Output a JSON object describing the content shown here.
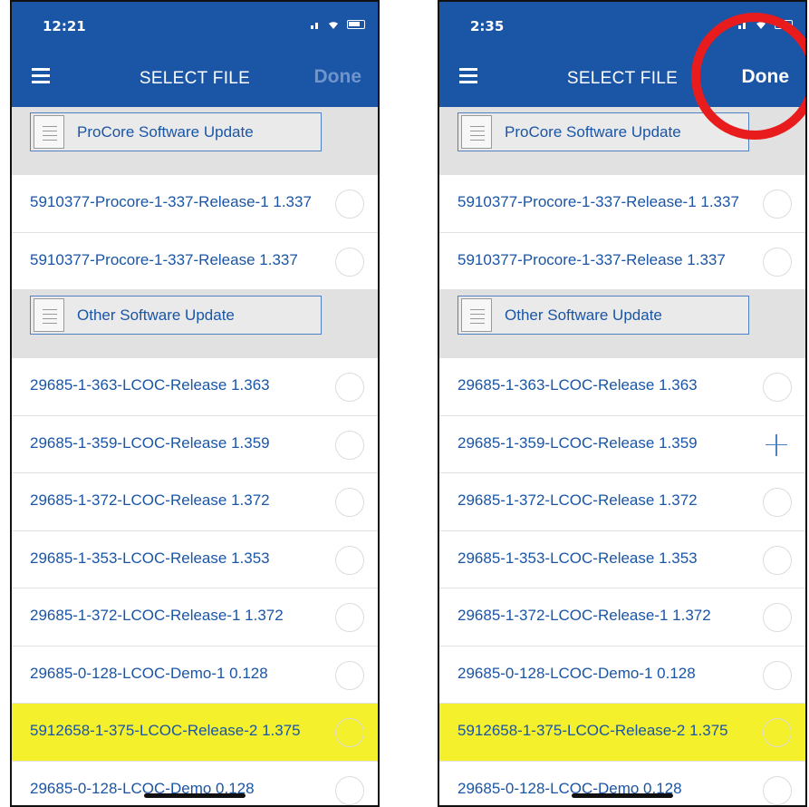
{
  "colors": {
    "accent": "#1a55a6",
    "highlight": "#f5f02c",
    "annotation": "#e81c1c"
  },
  "left": {
    "time": "12:21",
    "title": "SELECT FILE",
    "done": "Done",
    "sections": [
      {
        "header": "ProCore Software Update",
        "icon": "document-icon",
        "rows": [
          {
            "label": "5910377-Procore-1-337-Release-1 1.337",
            "control": "radio",
            "highlight": false
          },
          {
            "label": "5910377-Procore-1-337-Release 1.337",
            "control": "radio",
            "highlight": false
          }
        ]
      },
      {
        "header": "Other Software Update",
        "icon": "document-icon",
        "rows": [
          {
            "label": "29685-1-363-LCOC-Release 1.363",
            "control": "radio",
            "highlight": false
          },
          {
            "label": "29685-1-359-LCOC-Release 1.359",
            "control": "radio",
            "highlight": false
          },
          {
            "label": "29685-1-372-LCOC-Release 1.372",
            "control": "radio",
            "highlight": false
          },
          {
            "label": "29685-1-353-LCOC-Release 1.353",
            "control": "radio",
            "highlight": false
          },
          {
            "label": "29685-1-372-LCOC-Release-1 1.372",
            "control": "radio",
            "highlight": false
          },
          {
            "label": "29685-0-128-LCOC-Demo-1 0.128",
            "control": "radio",
            "highlight": false
          },
          {
            "label": "5912658-1-375-LCOC-Release-2 1.375",
            "control": "radio",
            "highlight": true
          },
          {
            "label": "29685-0-128-LCOC-Demo 0.128",
            "control": "radio",
            "highlight": false
          }
        ]
      }
    ]
  },
  "right": {
    "time": "2:35",
    "title": "SELECT FILE",
    "done": "Done",
    "sections": [
      {
        "header": "ProCore Software Update",
        "icon": "document-icon",
        "rows": [
          {
            "label": "5910377-Procore-1-337-Release-1 1.337",
            "control": "radio",
            "highlight": false
          },
          {
            "label": "5910377-Procore-1-337-Release 1.337",
            "control": "radio",
            "highlight": false
          }
        ]
      },
      {
        "header": "Other Software Update",
        "icon": "document-icon",
        "rows": [
          {
            "label": "29685-1-363-LCOC-Release 1.363",
            "control": "radio",
            "highlight": false
          },
          {
            "label": "29685-1-359-LCOC-Release 1.359",
            "control": "plus",
            "highlight": false
          },
          {
            "label": "29685-1-372-LCOC-Release 1.372",
            "control": "radio",
            "highlight": false
          },
          {
            "label": "29685-1-353-LCOC-Release 1.353",
            "control": "radio",
            "highlight": false
          },
          {
            "label": "29685-1-372-LCOC-Release-1 1.372",
            "control": "radio",
            "highlight": false
          },
          {
            "label": "29685-0-128-LCOC-Demo-1 0.128",
            "control": "radio",
            "highlight": false
          },
          {
            "label": "5912658-1-375-LCOC-Release-2 1.375",
            "control": "radio",
            "highlight": true
          },
          {
            "label": "29685-0-128-LCOC-Demo 0.128",
            "control": "radio",
            "highlight": false
          }
        ]
      }
    ]
  }
}
